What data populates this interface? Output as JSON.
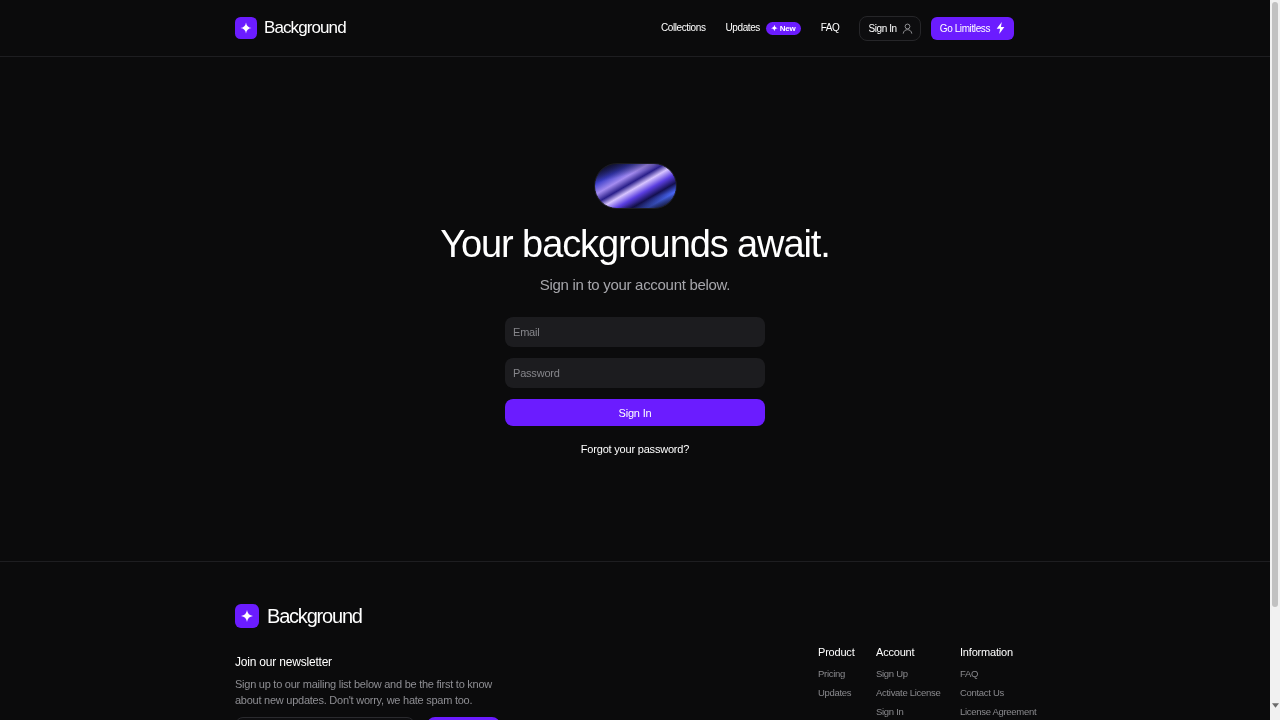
{
  "header": {
    "brand": "Background",
    "nav": [
      {
        "label": "Collections"
      },
      {
        "label": "Updates",
        "badge": "✦ New"
      },
      {
        "label": "FAQ"
      }
    ],
    "sign_in": "Sign In",
    "cta": "Go Limitless"
  },
  "hero": {
    "title": "Your backgrounds await.",
    "subtitle": "Sign in to your account below.",
    "fields": [
      {
        "placeholder": "Email"
      },
      {
        "placeholder": "Password"
      }
    ],
    "submit": "Sign In",
    "forgot_link": "Forgot your password?"
  },
  "footer": {
    "brand": "Background",
    "newsletter": {
      "title": "Join our newsletter",
      "text": "Sign up to our mailing list below and be the first to know about new updates. Don't worry, we hate spam too."
    },
    "columns": [
      {
        "heading": "Product",
        "links": [
          "Pricing",
          "Updates"
        ]
      },
      {
        "heading": "Account",
        "links": [
          "Sign Up",
          "Activate License",
          "Sign In"
        ]
      },
      {
        "heading": "Information",
        "links": [
          "FAQ",
          "Contact Us",
          "License Agreement"
        ]
      }
    ]
  }
}
